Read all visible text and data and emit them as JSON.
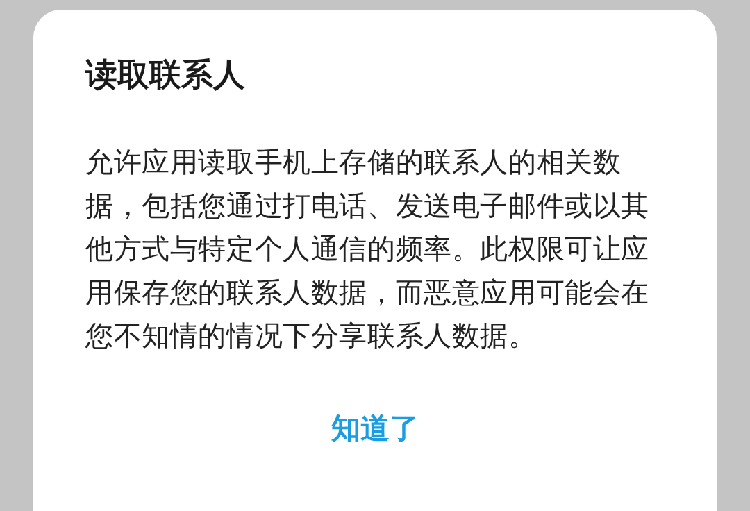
{
  "dialog": {
    "title": "读取联系人",
    "message": "允许应用读取手机上存储的联系人的相关数据，包括您通过打电话、发送电子邮件或以其他方式与特定个人通信的频率。此权限可让应用保存您的联系人数据，而恶意应用可能会在您不知情的情况下分享联系人数据。",
    "buttons": [
      "知道了"
    ]
  }
}
